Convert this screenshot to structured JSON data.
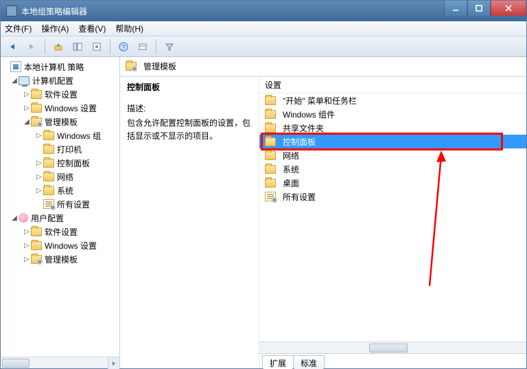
{
  "window": {
    "title": "本地组策略编辑器"
  },
  "menu": {
    "file": "文件(F)",
    "action": "操作(A)",
    "view": "查看(V)",
    "help": "帮助(H)"
  },
  "tree": {
    "root": "本地计算机 策略",
    "computer": "计算机配置",
    "c_soft": "软件设置",
    "c_win": "Windows 设置",
    "c_admin": "管理模板",
    "c_admin_win": "Windows 组",
    "c_admin_printer": "打印机",
    "c_admin_cp": "控制面板",
    "c_admin_net": "网络",
    "c_admin_sys": "系统",
    "c_admin_all": "所有设置",
    "user": "用户配置",
    "u_soft": "软件设置",
    "u_win": "Windows 设置",
    "u_admin": "管理模板"
  },
  "right": {
    "header": "管理模板",
    "selected": "控制面板",
    "desc_label": "描述:",
    "desc_text": "包含允许配置控制面板的设置，包括显示或不显示的项目。",
    "col_setting": "设置",
    "items": [
      "\"开始\" 菜单和任务栏",
      "Windows 组件",
      "共享文件夹",
      "控制面板",
      "网络",
      "系统",
      "桌面",
      "所有设置"
    ],
    "selected_index": 3,
    "tabs": {
      "ext": "扩展",
      "std": "标准"
    }
  }
}
